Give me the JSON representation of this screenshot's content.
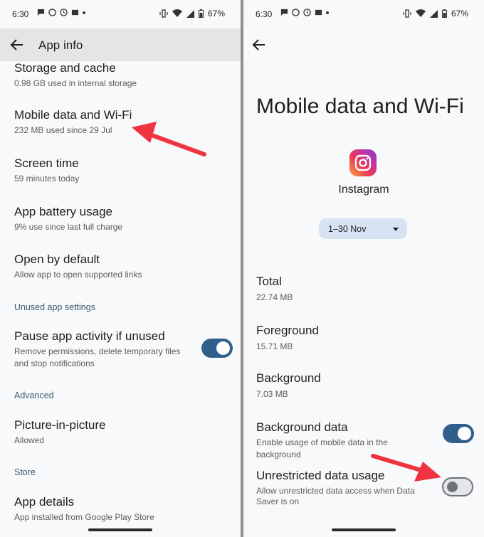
{
  "left": {
    "status": {
      "time": "6:30",
      "battery": "67%"
    },
    "title": "App info",
    "items": [
      {
        "title": "Storage and cache",
        "sub": "0.98 GB used in internal storage"
      },
      {
        "title": "Mobile data and Wi-Fi",
        "sub": "232 MB used since 29 Jul"
      },
      {
        "title": "Screen time",
        "sub": "59 minutes today"
      },
      {
        "title": "App battery usage",
        "sub": "9% use since last full charge"
      },
      {
        "title": "Open by default",
        "sub": "Allow app to open supported links"
      },
      {
        "title": "Pause app activity if unused",
        "sub": "Remove permissions, delete temporary files and stop notifications",
        "toggle_on": true
      },
      {
        "title": "Picture-in-picture",
        "sub": "Allowed"
      },
      {
        "title": "App details",
        "sub": "App installed from Google Play Store"
      }
    ],
    "sections": {
      "unused": "Unused app settings",
      "advanced": "Advanced",
      "store": "Store"
    }
  },
  "right": {
    "status": {
      "time": "6:30",
      "battery": "67%"
    },
    "title": "Mobile data and Wi-Fi",
    "app_name": "Instagram",
    "date_range": "1–30 Nov",
    "stats": [
      {
        "title": "Total",
        "value": "22.74 MB"
      },
      {
        "title": "Foreground",
        "value": "15.71 MB"
      },
      {
        "title": "Background",
        "value": "7.03 MB"
      }
    ],
    "background_data": {
      "title": "Background data",
      "sub": "Enable usage of mobile data in the background",
      "toggle_on": true
    },
    "unrestricted": {
      "title": "Unrestricted data usage",
      "sub": "Allow unrestricted data access when Data Saver is on",
      "toggle_on": false
    }
  },
  "colors": {
    "accent": "#2f5f8a",
    "arrow": "#ef3340",
    "dropdown": "#d7e3f3"
  }
}
